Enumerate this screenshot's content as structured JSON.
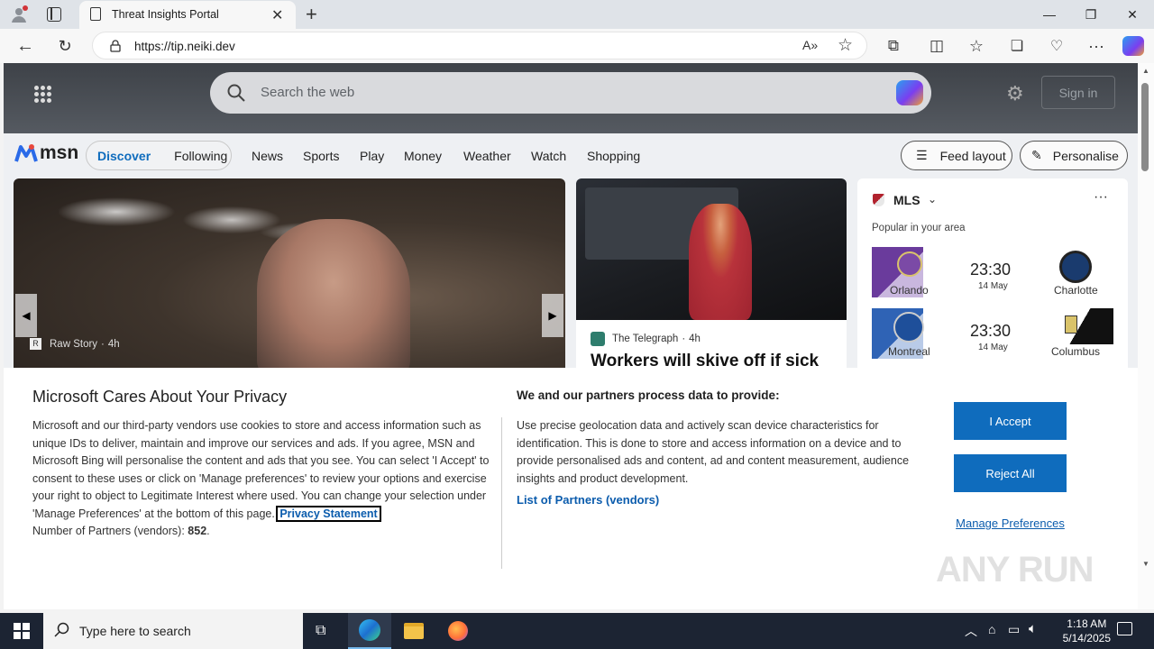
{
  "browser": {
    "tab_title": "Threat Insights Portal",
    "url": "https://tip.neiki.dev"
  },
  "page": {
    "search_placeholder": "Search the web",
    "sign_in": "Sign in",
    "brand": "msn",
    "nav_pills": [
      "Discover",
      "Following"
    ],
    "nav_links": [
      "News",
      "Sports",
      "Play",
      "Money",
      "Weather",
      "Watch",
      "Shopping"
    ],
    "feed_layout": "Feed layout",
    "personalise": "Personalise",
    "hero_source": "Raw Story",
    "hero_age": "4h",
    "card_source": "The Telegraph",
    "card_age": "4h",
    "card_headline": "Workers will skive off if sick",
    "mls": {
      "league": "MLS",
      "subtitle": "Popular in your area",
      "matches": [
        {
          "home": "Orlando",
          "away": "Charlotte",
          "time": "23:30",
          "date": "14 May"
        },
        {
          "home": "Montreal",
          "away": "Columbus",
          "time": "23:30",
          "date": "14 May"
        }
      ]
    }
  },
  "privacy": {
    "title": "Microsoft Cares About Your Privacy",
    "body": "Microsoft and our third-party vendors use cookies to store and access information such as unique IDs to deliver, maintain and improve our services and ads. If you agree, MSN and Microsoft Bing will personalise the content and ads that you see. You can select 'I Accept' to consent to these uses or click on 'Manage preferences' to review your options and exercise your right to object to Legitimate Interest where used.  You can change your selection under 'Manage Preferences' at the bottom of this page.",
    "privacy_link": "Privacy Statement",
    "partners_label": "Number of Partners (vendors):",
    "partners_count": "852",
    "right_title": "We and our partners process data to provide:",
    "right_body": "Use precise geolocation data and actively scan device characteristics for identification. This is done to store and access information on a device and to provide personalised ads and content, ad and content measurement, audience insights and product development.",
    "partners_link": "List of Partners (vendors)",
    "accept": "I Accept",
    "reject": "Reject All",
    "manage": "Manage Preferences"
  },
  "watermark": "ANY RUN",
  "taskbar": {
    "search_placeholder": "Type here to search",
    "time": "1:18 AM",
    "date": "5/14/2025"
  },
  "colors": {
    "accent": "#0f6cbd",
    "link": "#0b5cad",
    "taskbar": "#1c2433"
  }
}
